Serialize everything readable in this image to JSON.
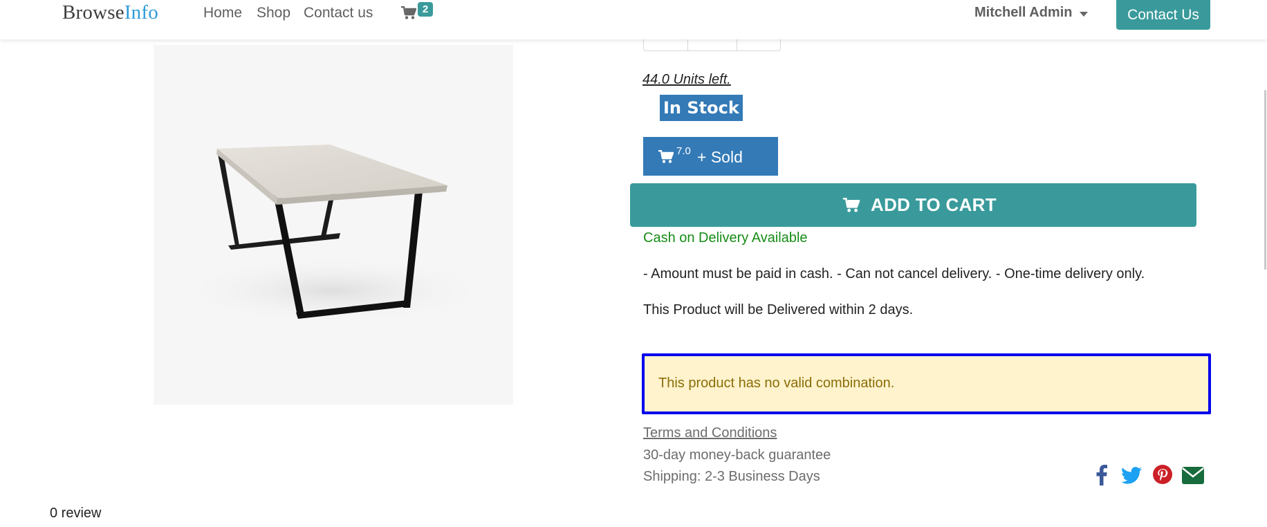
{
  "header": {
    "brand_part1": "Browse",
    "brand_part2": "Info",
    "nav": [
      "Home",
      "Shop",
      "Contact us"
    ],
    "cart_count": "2",
    "user_name": "Mitchell Admin",
    "contact_button": "Contact Us"
  },
  "product": {
    "image_icon": "table-product-image",
    "units_left": "44.0 Units left.",
    "stock_status": "In Stock",
    "sold_count": "7.0",
    "sold_label": "+ Sold",
    "add_to_cart_label": "ADD TO CART",
    "cod_title": "Cash on Delivery Available",
    "cod_terms": "- Amount must be paid in cash. - Can not cancel delivery. - One-time delivery only.",
    "delivery_info": "This Product will be Delivered within 2 days.",
    "combination_alert": "This product has no valid combination.",
    "terms_link": "Terms and Conditions",
    "guarantee": "30-day money-back guarantee",
    "shipping": "Shipping: 2-3 Business Days"
  },
  "share": {
    "icons": [
      "facebook-icon",
      "twitter-icon",
      "pinterest-icon",
      "email-icon"
    ]
  },
  "reviews": {
    "label": "0 review"
  },
  "colors": {
    "brand_accent": "#2f9ad8",
    "teal": "#3a9a9b",
    "blue_button": "#337ab7",
    "cod_green": "#168c16",
    "alert_bg": "#fff3cd",
    "alert_outline": "#0000ee"
  }
}
